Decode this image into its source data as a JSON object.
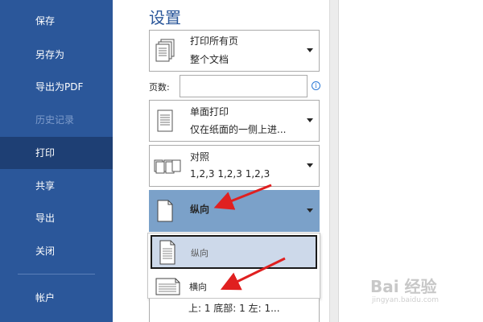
{
  "sidebar": {
    "items": [
      {
        "label": "保存"
      },
      {
        "label": "另存为"
      },
      {
        "label": "导出为PDF"
      },
      {
        "label": "历史记录"
      },
      {
        "label": "打印"
      },
      {
        "label": "共享"
      },
      {
        "label": "导出"
      },
      {
        "label": "关闭"
      },
      {
        "label": "帐户"
      }
    ]
  },
  "settings": {
    "title": "设置",
    "print_range": {
      "line1": "打印所有页",
      "line2": "整个文档"
    },
    "pages": {
      "label": "页数:",
      "value": ""
    },
    "sides": {
      "line1": "单面打印",
      "line2": "仅在纸面的一侧上进..."
    },
    "collate": {
      "line1": "对照",
      "line2": "1,2,3    1,2,3    1,2,3"
    },
    "orientation": {
      "selected": "纵向"
    },
    "orientation_options": [
      {
        "label": "纵向"
      },
      {
        "label": "横向"
      }
    ],
    "margins_peek": "上: 1   底部: 1   左: 1..."
  },
  "watermark": {
    "main": "Bai  经验",
    "sub": "jingyan.baidu.com"
  },
  "colors": {
    "sidebar": "#2b579a",
    "active_nav": "#1e3f74",
    "selected_dropdown": "#7ba1c9",
    "annotation_arrow": "#e02020"
  }
}
